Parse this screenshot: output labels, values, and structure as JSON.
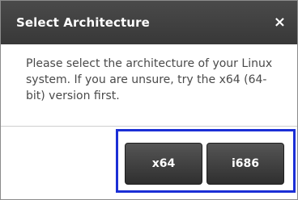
{
  "dialog": {
    "title": "Select Architecture",
    "close_label": "×",
    "message": "Please select the architecture of your Linux system. If you are unsure, try the x64 (64-bit) version first.",
    "buttons": {
      "x64": "x64",
      "i686": "i686"
    }
  },
  "colors": {
    "titlebar": "#404040",
    "highlight_border": "#1b2fd6",
    "button_bg": "#3f3f3f",
    "message_text": "#4a4a4a"
  },
  "icons": {
    "close": "close-icon"
  }
}
